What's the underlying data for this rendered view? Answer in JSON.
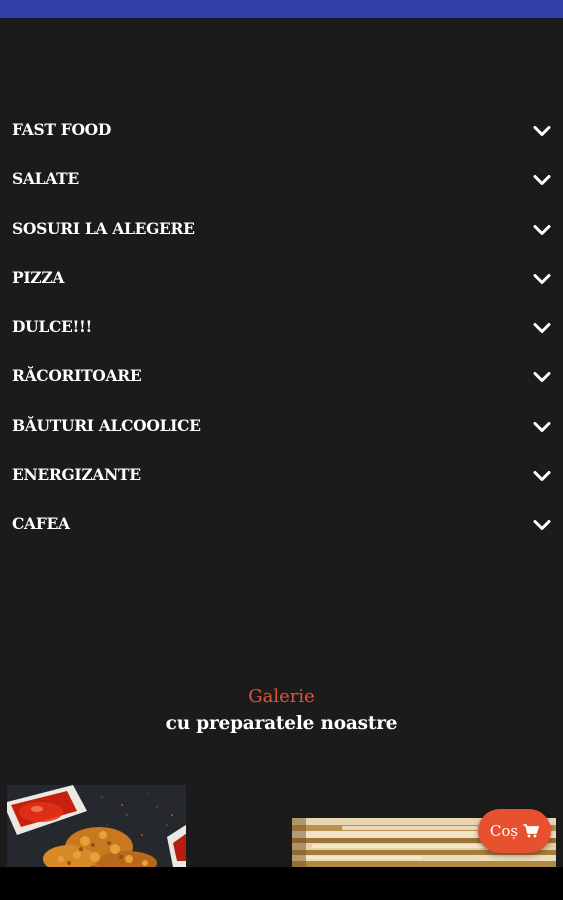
{
  "menu": {
    "categories": [
      {
        "label": "FAST FOOD"
      },
      {
        "label": "SALATE"
      },
      {
        "label": "SOSURI LA ALEGERE"
      },
      {
        "label": "PIZZA"
      },
      {
        "label": "DULCE!!!"
      },
      {
        "label": "RĂCORITOARE"
      },
      {
        "label": "BĂUTURI ALCOOLICE"
      },
      {
        "label": "ENERGIZANTE"
      },
      {
        "label": "CAFEA"
      }
    ],
    "expand_icon": "chevron-down-icon"
  },
  "gallery": {
    "title": "Galerie",
    "subtitle": "cu preparatele noastre"
  },
  "cart": {
    "label": "Coș",
    "icon": "cart-icon"
  },
  "colors": {
    "background": "#1b1b1c",
    "status_bar": "#3340a8",
    "accent": "#e8512f",
    "gallery_title": "#e0553a",
    "text": "#ffffff"
  }
}
